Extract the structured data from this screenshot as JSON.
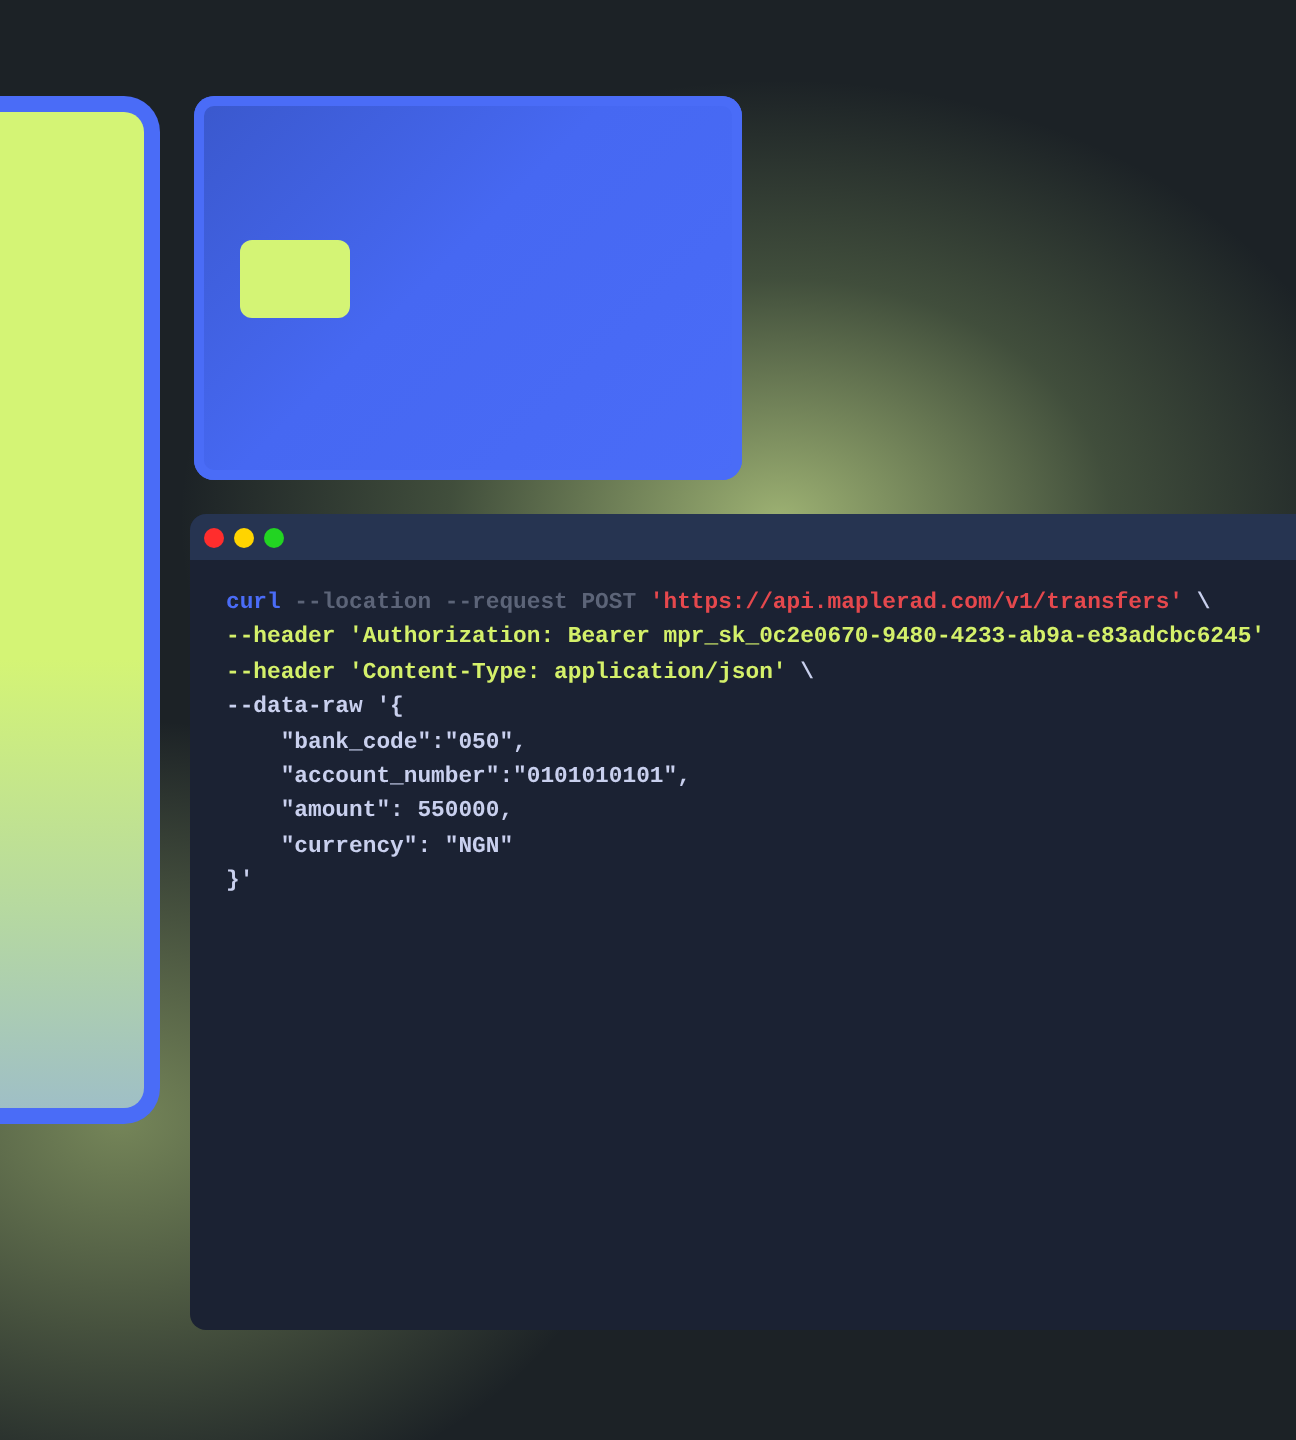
{
  "code_window": {
    "lines": [
      {
        "tokens": [
          {
            "kind": "command",
            "text": "curl"
          },
          {
            "kind": "flag",
            "text": " --location --request POST "
          },
          {
            "kind": "url",
            "text": "'https://api.maplerad.com/v1/transfers'"
          },
          {
            "kind": "plain",
            "text": " \\"
          }
        ]
      },
      {
        "tokens": [
          {
            "kind": "header",
            "text": "--header 'Authorization: Bearer mpr_sk_0c2e0670-9480-4233-ab9a-e83adcbc6245'"
          }
        ]
      },
      {
        "tokens": [
          {
            "kind": "header",
            "text": "--header 'Content-Type: application/json'"
          },
          {
            "kind": "plain",
            "text": " \\"
          }
        ]
      },
      {
        "tokens": [
          {
            "kind": "plain",
            "text": "--data-raw '{"
          }
        ]
      },
      {
        "tokens": [
          {
            "kind": "plain",
            "text": "    \"bank_code\":\"050\","
          }
        ]
      },
      {
        "tokens": [
          {
            "kind": "plain",
            "text": "    \"account_number\":\"0101010101\","
          }
        ]
      },
      {
        "tokens": [
          {
            "kind": "plain",
            "text": "    \"amount\": 550000,"
          }
        ]
      },
      {
        "tokens": [
          {
            "kind": "plain",
            "text": "    \"currency\": \"NGN\""
          }
        ]
      },
      {
        "tokens": [
          {
            "kind": "plain",
            "text": "}'"
          }
        ]
      }
    ]
  }
}
